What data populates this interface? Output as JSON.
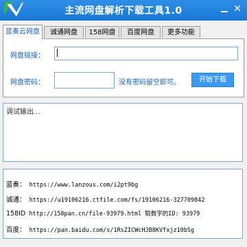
{
  "window": {
    "title": "主流网盘解析下载工具1.0",
    "minimize_label": "minimize",
    "close_label": "✕"
  },
  "tabs": [
    {
      "label": "蓝奏云网盘",
      "active": true
    },
    {
      "label": "诚通网盘",
      "active": false
    },
    {
      "label": "158网盘",
      "active": false
    },
    {
      "label": "百度网盘",
      "active": false
    },
    {
      "label": "更多功能",
      "active": false
    }
  ],
  "form": {
    "link_label": "网盘链接：",
    "link_value": "",
    "password_label": "网盘密码：",
    "password_value": "",
    "hint": "没有密码留空即可。",
    "start_button": "开始下载"
  },
  "debug": {
    "text": "调试输出..."
  },
  "links": [
    {
      "name": "蓝奏：",
      "url": " https://www.lanzous.com/i2pt9bg"
    },
    {
      "name": "诚通：",
      "url": " https://u19106216.ctfile.com/fs/19106216-327709842"
    },
    {
      "name": "158ID",
      "url": " http://158pan.cn/file-93979.html 取数字的ID: 93979"
    },
    {
      "name": "百度：",
      "url": " https://pan.baidu.com/s/1RsZICWcHJB8KVfxjz10bSg"
    }
  ],
  "colors": {
    "titlebar": "#1f82dc",
    "accent": "#3b9af0",
    "label_text": "#1a5fb4"
  }
}
